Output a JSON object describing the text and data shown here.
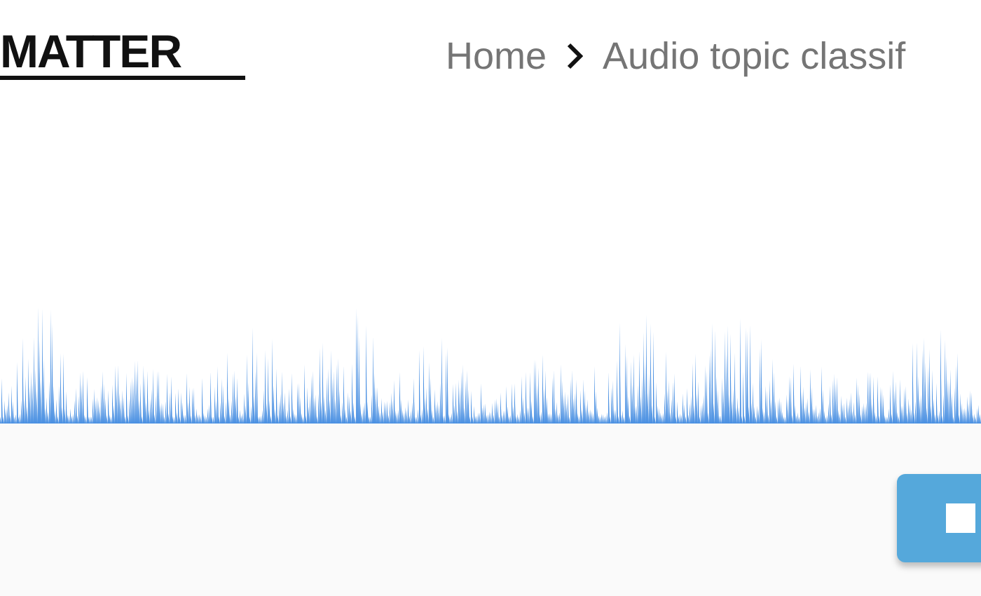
{
  "logo": {
    "text": "MATTER"
  },
  "breadcrumb": [
    {
      "label": "Home"
    },
    {
      "label": "Audio topic classif"
    }
  ]
}
